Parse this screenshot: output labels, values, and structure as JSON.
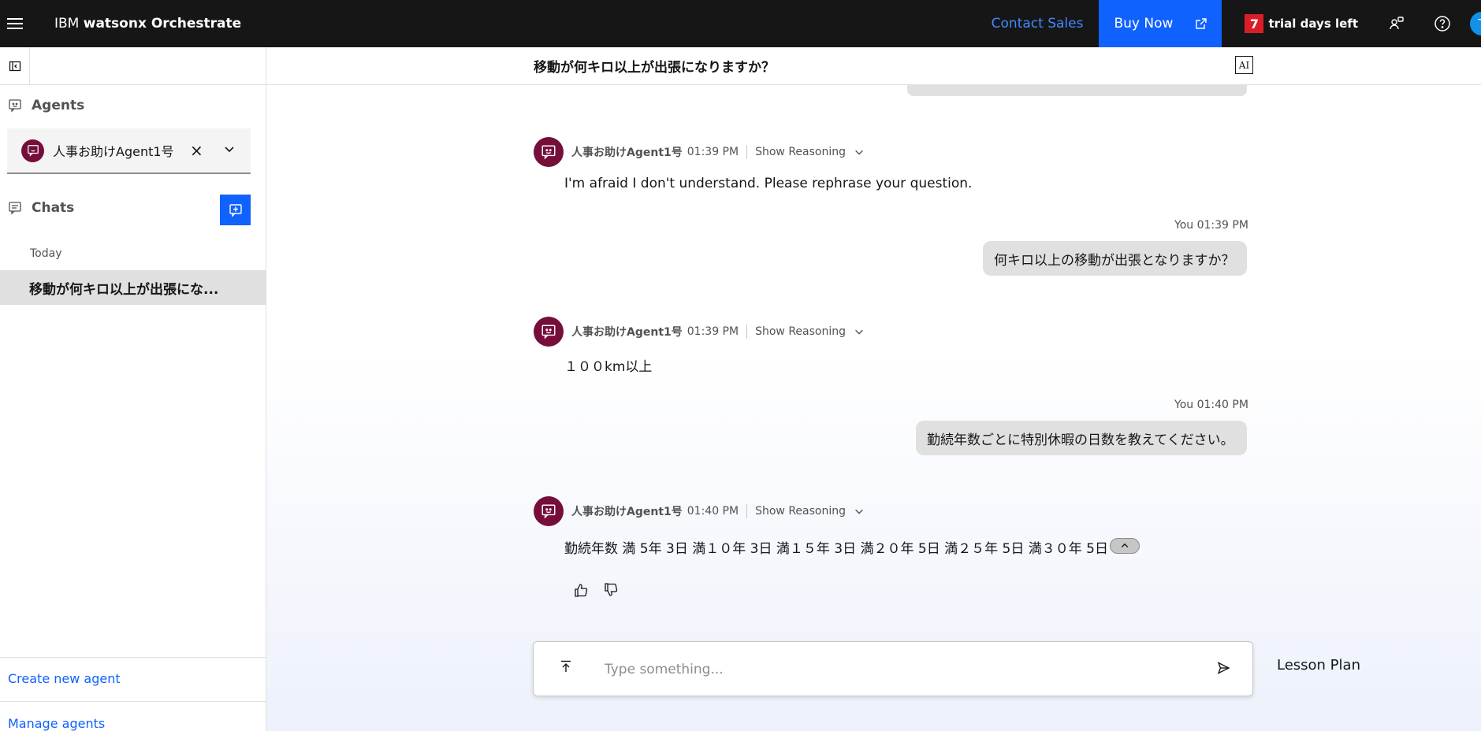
{
  "topbar": {
    "brand_prefix": "IBM",
    "brand_name": "watsonx Orchestrate",
    "contact_label": "Contact Sales",
    "buy_label": "Buy Now",
    "trial_days": "7",
    "trial_label": "trial days left",
    "user_initial": "T"
  },
  "sidebar": {
    "agents_label": "Agents",
    "selected_agent": "人事お助けAgent1号",
    "chats_label": "Chats",
    "today_label": "Today",
    "chat_items": [
      {
        "title": "移動が何キロ以上が出張にな..."
      }
    ],
    "create_agent_label": "Create new agent",
    "manage_agents_label": "Manage agents"
  },
  "main": {
    "title": "移動が何キロ以上が出張になりますか？",
    "ai_badge": "AI",
    "reasoning_label": "Show Reasoning",
    "messages": [
      {
        "role": "agent",
        "name": "人事お助けAgent1号",
        "time": "01:39 PM",
        "text": "I'm afraid I don't understand. Please rephrase your question."
      },
      {
        "role": "user",
        "label": "You 01:39 PM",
        "text": "何キロ以上の移動が出張となりますか？"
      },
      {
        "role": "agent",
        "name": "人事お助けAgent1号",
        "time": "01:39 PM",
        "text": "１００km以上"
      },
      {
        "role": "user",
        "label": "You 01:40 PM",
        "text": "勤続年数ごとに特別休暇の日数を教えてください。"
      },
      {
        "role": "agent",
        "name": "人事お助けAgent1号",
        "time": "01:40 PM",
        "text": "勤続年数 満 5年 3日 満１０年 3日 満１５年 3日 満２０年 5日 満２５年 5日 満３０年 5日"
      }
    ],
    "input_placeholder": "Type something...",
    "side_label": "Lesson Plan"
  }
}
